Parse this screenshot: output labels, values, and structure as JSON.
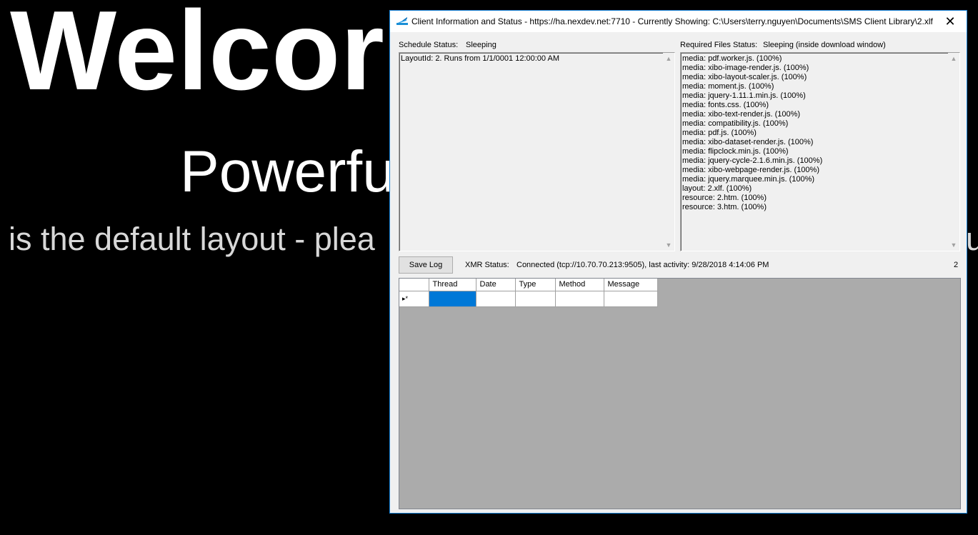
{
  "background": {
    "welcome": "Welcor",
    "powerful": "Powerfu",
    "default_line": "is the default layout - plea",
    "default_tail": "u"
  },
  "window": {
    "title": "Client Information and Status - https://ha.nexdev.net:7710 - Currently Showing: C:\\Users\\terry.nguyen\\Documents\\SMS Client Library\\2.xlf",
    "close_glyph": "✕"
  },
  "schedule": {
    "label": "Schedule Status:",
    "value": "Sleeping",
    "lines": [
      "LayoutId: 2. Runs from 1/1/0001 12:00:00 AM"
    ]
  },
  "required_files": {
    "label": "Required Files Status:",
    "value": "Sleeping (inside download window)",
    "lines": [
      "media: pdf.worker.js. (100%)",
      "media: xibo-image-render.js. (100%)",
      "media: xibo-layout-scaler.js. (100%)",
      "media: moment.js. (100%)",
      "media: jquery-1.11.1.min.js. (100%)",
      "media: fonts.css. (100%)",
      "media: xibo-text-render.js. (100%)",
      "media: compatibility.js. (100%)",
      "media: pdf.js. (100%)",
      "media: xibo-dataset-render.js. (100%)",
      "media: flipclock.min.js. (100%)",
      "media: jquery-cycle-2.1.6.min.js. (100%)",
      "media: xibo-webpage-render.js. (100%)",
      "media: jquery.marquee.min.js. (100%)",
      "layout: 2.xlf. (100%)",
      "resource: 2.htm. (100%)",
      "resource: 3.htm. (100%)"
    ]
  },
  "toolbar": {
    "save_log": "Save Log",
    "xmr_label": "XMR Status:",
    "xmr_value": "Connected (tcp://10.70.70.213:9505), last activity: 9/28/2018 4:14:06 PM",
    "count": "2"
  },
  "log_grid": {
    "columns": [
      "Thread",
      "Date",
      "Type",
      "Method",
      "Message"
    ],
    "new_row_marker": "▸*"
  },
  "colors": {
    "selection": "#0078d7",
    "window_border": "#1883d7",
    "grid_background": "#ababab"
  }
}
